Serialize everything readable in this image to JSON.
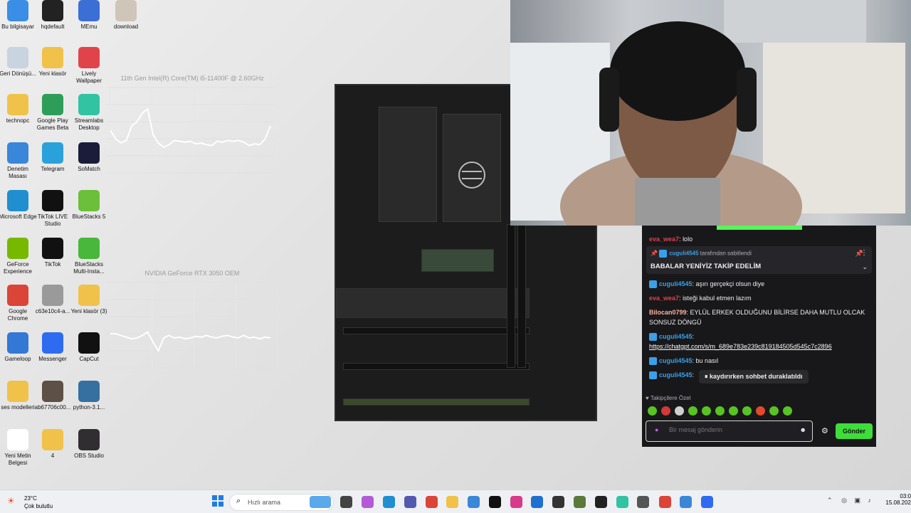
{
  "desktop_icons": [
    {
      "label": "Bu bilgisayar",
      "icon": "computer-icon",
      "color": "#3a8ee6"
    },
    {
      "label": "hqdefault",
      "icon": "image-icon",
      "color": "#222222"
    },
    {
      "label": "MEmu",
      "icon": "memu-icon",
      "color": "#3b6fd6"
    },
    {
      "label": "download",
      "icon": "image-icon",
      "color": "#cfc5b8"
    },
    {
      "label": "Geri Dönüşü...",
      "icon": "recycle-bin-icon",
      "color": "#c8d4e0"
    },
    {
      "label": "Yeni klasör",
      "icon": "folder-icon",
      "color": "#f0c24a"
    },
    {
      "label": "Lively Wallpaper",
      "icon": "lively-icon",
      "color": "#e0444a"
    },
    {
      "label": "technopc",
      "icon": "folder-icon",
      "color": "#f0c24a"
    },
    {
      "label": "Google Play Games Beta",
      "icon": "play-games-icon",
      "color": "#2e9d5a"
    },
    {
      "label": "Streamlabs Desktop",
      "icon": "streamlabs-icon",
      "color": "#31c3a2"
    },
    {
      "label": "Denetim Masası",
      "icon": "control-panel-icon",
      "color": "#3a86d8"
    },
    {
      "label": "Telegram",
      "icon": "telegram-icon",
      "color": "#2aa1da"
    },
    {
      "label": "SoMatch",
      "icon": "somatch-icon",
      "color": "#1b1b3a"
    },
    {
      "label": "Microsoft Edge",
      "icon": "edge-icon",
      "color": "#1f8fd0"
    },
    {
      "label": "TikTok LIVE Studio",
      "icon": "tiktok-icon",
      "color": "#111111"
    },
    {
      "label": "BlueStacks 5",
      "icon": "bluestacks-icon",
      "color": "#6bbf3a"
    },
    {
      "label": "GeForce Experience",
      "icon": "nvidia-icon",
      "color": "#76b900"
    },
    {
      "label": "TikTok",
      "icon": "tiktok-icon",
      "color": "#111111"
    },
    {
      "label": "BlueStacks Multi-Insta...",
      "icon": "bluestacks-icon",
      "color": "#49b73a"
    },
    {
      "label": "Google Chrome",
      "icon": "chrome-icon",
      "color": "#db4437"
    },
    {
      "label": "c63e10c4-a...",
      "icon": "image-icon",
      "color": "#9a9a9a"
    },
    {
      "label": "Yeni klasör (3)",
      "icon": "folder-icon",
      "color": "#f0c24a"
    },
    {
      "label": "Gameloop",
      "icon": "gameloop-icon",
      "color": "#3378d4"
    },
    {
      "label": "Messenger",
      "icon": "messenger-icon",
      "color": "#2e6bf0"
    },
    {
      "label": "CapCut",
      "icon": "capcut-icon",
      "color": "#111111"
    },
    {
      "label": "ses modelleri",
      "icon": "folder-icon",
      "color": "#f0c24a"
    },
    {
      "label": "ab67706c00...",
      "icon": "image-icon",
      "color": "#5d5044"
    },
    {
      "label": "python-3.1...",
      "icon": "python-icon",
      "color": "#3670a0"
    },
    {
      "label": "Yeni Metin Belgesi",
      "icon": "text-file-icon",
      "color": "#ffffff"
    },
    {
      "label": "4",
      "icon": "folder-icon",
      "color": "#f0c24a"
    },
    {
      "label": "OBS Studio",
      "icon": "obs-icon",
      "color": "#302e31"
    }
  ],
  "widgets": {
    "cpu_title": "11th Gen Intel(R) Core(TM) i5-11400F @ 2.60GHz",
    "gpu_title": "NVIDIA GeForce RTX 3050 OEM",
    "cpu_values": [
      50,
      40,
      35,
      38,
      55,
      60,
      70,
      75,
      45,
      35,
      30,
      33,
      38,
      37,
      36,
      37,
      34,
      35,
      33,
      32,
      37,
      36,
      38,
      37,
      38,
      36,
      32,
      34,
      33,
      40,
      55
    ],
    "gpu_values": [
      40,
      40,
      38,
      36,
      34,
      35,
      38,
      42,
      30,
      20,
      35,
      38,
      35,
      36,
      34,
      35,
      37,
      36,
      38,
      36,
      35,
      37,
      38,
      36,
      35,
      38,
      35,
      36,
      34,
      36,
      35
    ],
    "gpu_axis": [
      "100",
      "90",
      "80",
      "70",
      "60",
      "50",
      "40",
      "30",
      "20",
      "10"
    ]
  },
  "chat": {
    "top_message": {
      "user": "eva_wea7",
      "text": "lolo"
    },
    "pinned": {
      "user": "cuguli4545",
      "suffix": "tarafından sabitlendi",
      "text": "BABALAR YENİYİZ TAKİP EDELİM"
    },
    "messages": [
      {
        "user": "cuguli4545",
        "user_color": "#3aa0e8",
        "text": "aşırı gerçekçi olsun diye"
      },
      {
        "user": "eva_wea7",
        "user_color": "#e0414a",
        "text": "isteği kabul etmen lazım"
      },
      {
        "user": "Bilocan0799",
        "user_color": "#ffb0a0",
        "text": "EYLÜL ERKEK OLDUĞUNU BİLİRSE DAHA MUTLU OLCAK SONSUZ DÖNGÜ"
      },
      {
        "user": "cuguli4545",
        "user_color": "#3aa0e8",
        "text": "",
        "link": "https://chatgpt.com/s/m_689e783e239c819184505d545c7c2896"
      },
      {
        "user": "cuguli4545",
        "user_color": "#3aa0e8",
        "text": "bu nasıl"
      },
      {
        "user": "cuguli4545",
        "user_color": "#3aa0e8",
        "text": ""
      }
    ],
    "paused_text": "kaydırırken sohbet duraklatıldı",
    "followers_label": "Takipçilere Özel",
    "input_placeholder": "Bir mesaj gönderin",
    "send_label": "Gönder",
    "emote_colors": [
      "#58c322",
      "#d23a3a",
      "#cfcfcf",
      "#58c322",
      "#58c322",
      "#58c322",
      "#58c322",
      "#58c322",
      "#e04a2a",
      "#58c322",
      "#58c322"
    ]
  },
  "taskbar": {
    "weather_temp": "23°C",
    "weather_desc": "Çok bulutlu",
    "search_placeholder": "Hızlı arama",
    "time": "03:0",
    "date": "15.08.202",
    "apps": [
      {
        "name": "chrome-like-icon",
        "color": "#5aa9ea"
      },
      {
        "name": "file-icon",
        "color": "#444444"
      },
      {
        "name": "copilot-icon",
        "color": "#b35ad9"
      },
      {
        "name": "edge-icon",
        "color": "#1f8fd0"
      },
      {
        "name": "teams-icon",
        "color": "#5558af"
      },
      {
        "name": "chrome-icon",
        "color": "#db4437"
      },
      {
        "name": "file-explorer-icon",
        "color": "#f0c24a"
      },
      {
        "name": "store-icon",
        "color": "#3a86d8"
      },
      {
        "name": "tiktok-icon",
        "color": "#111111"
      },
      {
        "name": "instagram-icon",
        "color": "#d83a8a"
      },
      {
        "name": "outlook-icon",
        "color": "#1f6fd0"
      },
      {
        "name": "steam-icon",
        "color": "#333333"
      },
      {
        "name": "minecraft-icon",
        "color": "#5a7a3a"
      },
      {
        "name": "terminal-icon",
        "color": "#222222"
      },
      {
        "name": "streamlabs-icon",
        "color": "#31c3a2"
      },
      {
        "name": "settings-icon",
        "color": "#555555"
      },
      {
        "name": "chrome-active-icon",
        "color": "#db4437"
      },
      {
        "name": "photo-icon",
        "color": "#3a86d8"
      },
      {
        "name": "messenger-icon",
        "color": "#2e6bf0"
      }
    ]
  }
}
